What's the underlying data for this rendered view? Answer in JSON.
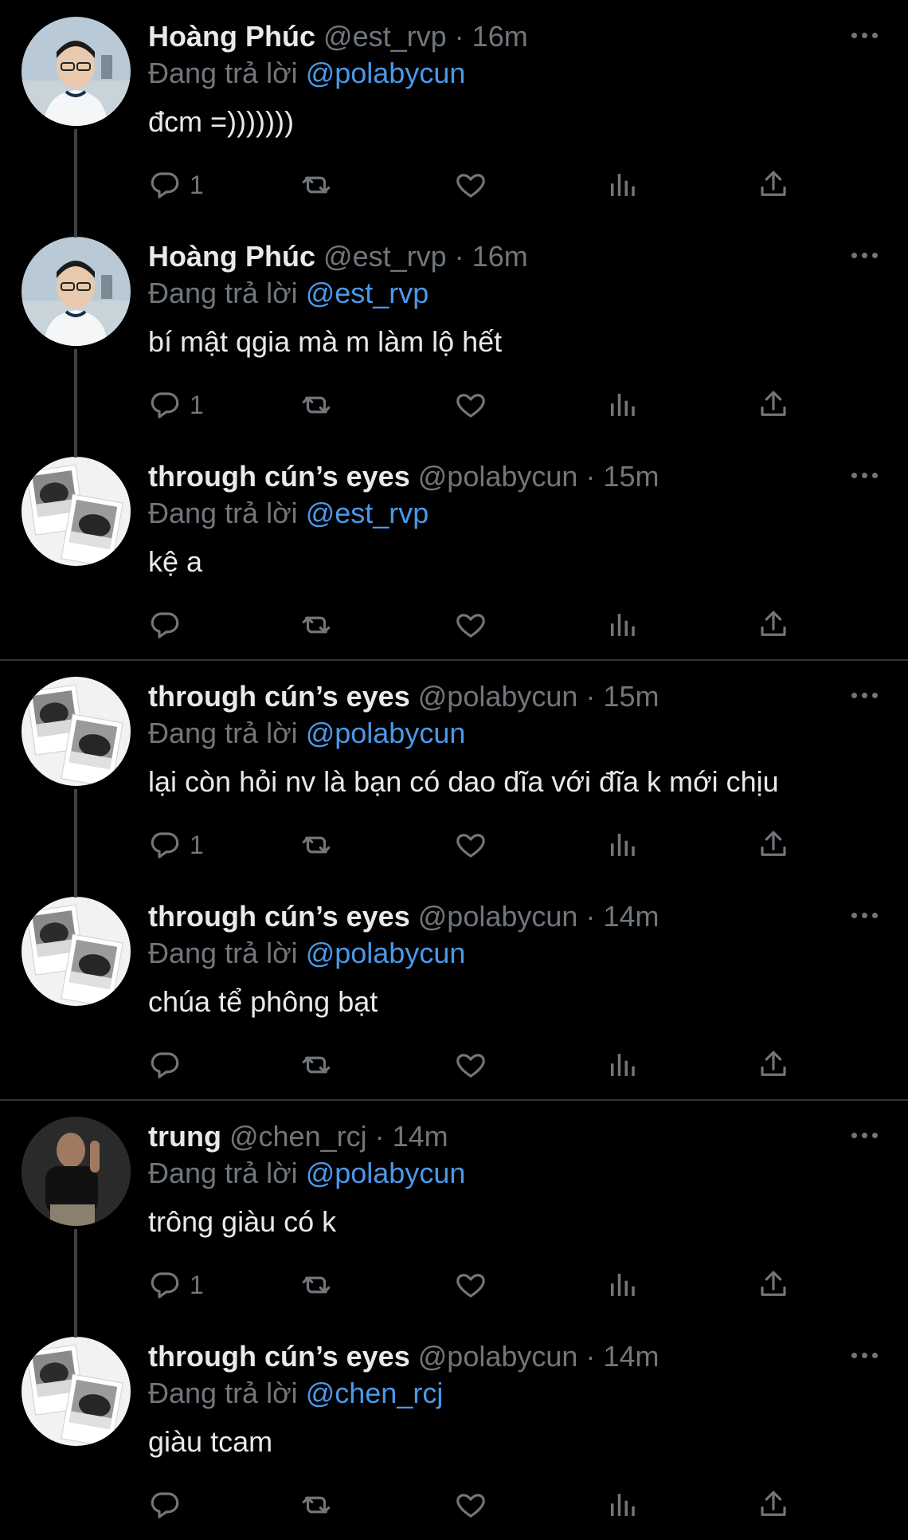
{
  "theme": {
    "background": "#000000",
    "text": "#e7e9ea",
    "muted": "#71767b",
    "mention": "#4a99e9",
    "divider": "#2f3336",
    "thread_line": "#3e4144"
  },
  "tweets": [
    {
      "name": "Hoàng Phúc",
      "handle": "@est_rvp",
      "dot": "·",
      "time": "16m",
      "reply_prefix": "Đang trả lời",
      "reply_to": "@polabycun",
      "text": "đcm =)))))))",
      "reply_count": "1",
      "avatar": "portrait-glasses-avatar"
    },
    {
      "name": "Hoàng Phúc",
      "handle": "@est_rvp",
      "dot": "·",
      "time": "16m",
      "reply_prefix": "Đang trả lời",
      "reply_to": "@est_rvp",
      "text": "bí mật qgia mà m làm lộ hết",
      "reply_count": "1",
      "avatar": "portrait-glasses-avatar"
    },
    {
      "name": "through cún’s eyes",
      "handle": "@polabycun",
      "dot": "·",
      "time": "15m",
      "reply_prefix": "Đang trả lời",
      "reply_to": "@est_rvp",
      "text": "kệ a",
      "reply_count": "",
      "avatar": "polaroid-avatar"
    },
    {
      "name": "through cún’s eyes",
      "handle": "@polabycun",
      "dot": "·",
      "time": "15m",
      "reply_prefix": "Đang trả lời",
      "reply_to": "@polabycun",
      "text": "lại còn hỏi nv là bạn có dao dĩa với đĩa k mới chịu",
      "reply_count": "1",
      "avatar": "polaroid-avatar"
    },
    {
      "name": "through cún’s eyes",
      "handle": "@polabycun",
      "dot": "·",
      "time": "14m",
      "reply_prefix": "Đang trả lời",
      "reply_to": "@polabycun",
      "text": "chúa tể phông bạt",
      "reply_count": "",
      "avatar": "polaroid-avatar"
    },
    {
      "name": "trung",
      "handle": "@chen_rcj",
      "dot": "·",
      "time": "14m",
      "reply_prefix": "Đang trả lời",
      "reply_to": "@polabycun",
      "text": "trông giàu có k",
      "reply_count": "1",
      "avatar": "dark-portrait-avatar"
    },
    {
      "name": "through cún’s eyes",
      "handle": "@polabycun",
      "dot": "·",
      "time": "14m",
      "reply_prefix": "Đang trả lời",
      "reply_to": "@chen_rcj",
      "text": "giàu tcam",
      "reply_count": "",
      "avatar": "polaroid-avatar"
    }
  ],
  "icons": {
    "reply": "reply-icon",
    "retweet": "retweet-icon",
    "like": "heart-icon",
    "views": "views-icon",
    "share": "share-icon",
    "more": "more-icon"
  }
}
